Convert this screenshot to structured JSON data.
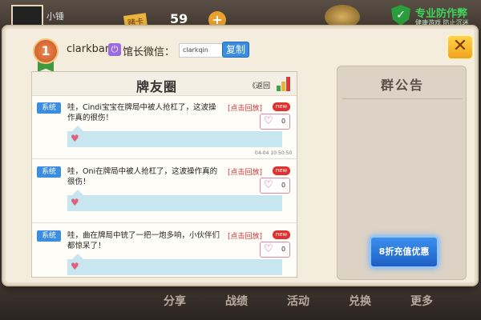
{
  "background": {
    "username": "小锤",
    "coin_tag": "赌卡",
    "coins": "59",
    "security_title": "专业防作弊",
    "security_subtitle": "健康游戏 防止沉迷",
    "nav": [
      "分享",
      "战绩",
      "活动",
      "兑换",
      "更多"
    ]
  },
  "dialog": {
    "rank": "1",
    "club_name": "clarkbar",
    "wechat_label": "馆长微信：",
    "wechat_value": "clarkqin",
    "copy_label": "复制",
    "close_label": "✕"
  },
  "friend_circle": {
    "title": "牌友圈",
    "back_label": "《返回",
    "posts": [
      {
        "tag": "系统",
        "text": "哇，Cindi宝宝在牌局中被人抢杠了，这波操作真的很伤！",
        "reply": "[点击回放]",
        "badge": "new",
        "likes": "0",
        "time": "04-04 10:50:50"
      },
      {
        "tag": "系统",
        "text": "哇，Oni在牌局中被人抢杠了，这波操作真的很伤！",
        "reply": "[点击回放]",
        "badge": "new",
        "likes": "0",
        "time": ""
      },
      {
        "tag": "系统",
        "text": "哇，曲在牌局中铳了一把一炮多响，小伙伴们都惊呆了！",
        "reply": "[点击回放]",
        "badge": "new",
        "likes": "0",
        "time": ""
      }
    ]
  },
  "notice": {
    "title": "群公告",
    "recharge_label": "8折充值优惠"
  },
  "colors": {
    "accent_blue": "#3a8de0",
    "reply_red": "#d03030",
    "close_yellow": "#f2a41c"
  }
}
